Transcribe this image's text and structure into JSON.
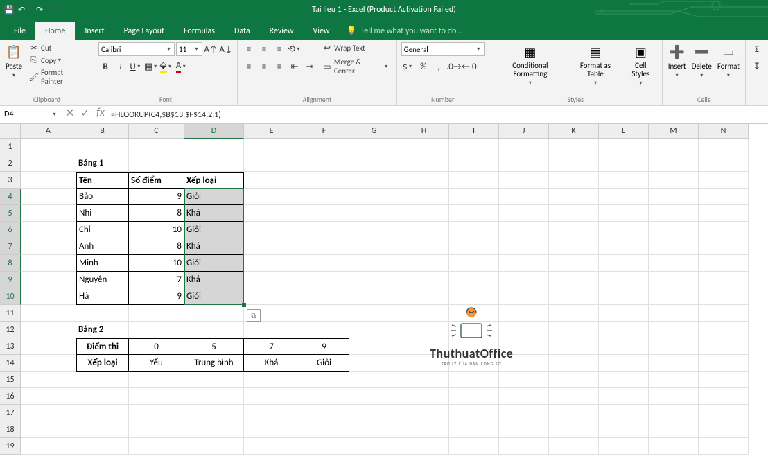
{
  "title": "Tai lieu 1 - Excel (Product Activation Failed)",
  "tabs": {
    "file": "File",
    "home": "Home",
    "insert": "Insert",
    "pagelayout": "Page Layout",
    "formulas": "Formulas",
    "data": "Data",
    "review": "Review",
    "view": "View",
    "tellme": "Tell me what you want to do..."
  },
  "clipboard": {
    "paste": "Paste",
    "cut": "Cut",
    "copy": "Copy",
    "painter": "Format Painter",
    "title": "Clipboard"
  },
  "font": {
    "name": "Calibri",
    "size": "11",
    "title": "Font"
  },
  "alignment": {
    "wrap": "Wrap Text",
    "merge": "Merge & Center",
    "title": "Alignment"
  },
  "number": {
    "format": "General",
    "title": "Number"
  },
  "styles": {
    "cond": "Conditional Formatting",
    "fmt": "Format as Table",
    "cell": "Cell Styles",
    "title": "Styles"
  },
  "cells": {
    "insert": "Insert",
    "delete": "Delete",
    "format": "Format",
    "title": "Cells"
  },
  "namebox": "D4",
  "formula": "=HLOOKUP(C4,$B$13:$F$14,2,1)",
  "cols": [
    "A",
    "B",
    "C",
    "D",
    "E",
    "F",
    "G",
    "H",
    "I",
    "J",
    "K",
    "L",
    "M",
    "N"
  ],
  "rows": [
    "1",
    "2",
    "3",
    "4",
    "5",
    "6",
    "7",
    "8",
    "9",
    "10",
    "11",
    "12",
    "13",
    "14",
    "15",
    "16",
    "17",
    "18",
    "19"
  ],
  "t1": {
    "title": "Bảng 1",
    "h": [
      "Tên",
      "Số điểm",
      "Xếp loại"
    ],
    "r": [
      [
        "Bảo",
        "9",
        "Giỏi"
      ],
      [
        "Nhi",
        "8",
        "Khá"
      ],
      [
        "Chi",
        "10",
        "Giỏi"
      ],
      [
        "Anh",
        "8",
        "Khá"
      ],
      [
        "Minh",
        "10",
        "Giỏi"
      ],
      [
        "Nguyên",
        "7",
        "Khá"
      ],
      [
        "Hà",
        "9",
        "Giỏi"
      ]
    ]
  },
  "t2": {
    "title": "Bảng 2",
    "r1": [
      "Điểm thi",
      "0",
      "5",
      "7",
      "9"
    ],
    "r2": [
      "Xếp loại",
      "Yếu",
      "Trung bình",
      "Khá",
      "Giỏi"
    ]
  },
  "wm": {
    "t1": "ThuthuatOffice",
    "t2": "TRỢ LÝ CỦA DÂN CÔNG SỞ"
  }
}
